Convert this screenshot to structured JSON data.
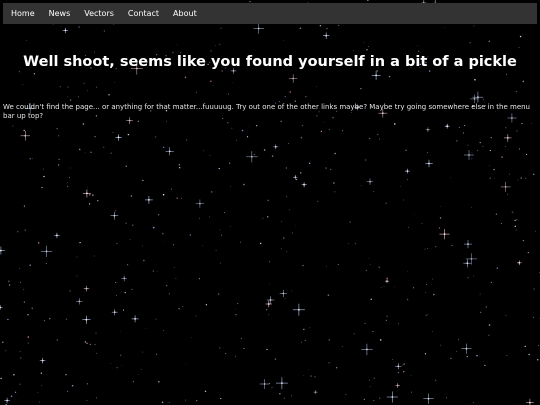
{
  "nav": {
    "items": [
      {
        "label": "Home"
      },
      {
        "label": "News"
      },
      {
        "label": "Vectors"
      },
      {
        "label": "Contact"
      },
      {
        "label": "About"
      }
    ]
  },
  "main": {
    "title": "Well shoot, seems like you found yourself in a bit of a pickle",
    "message": "We couldn't find the page... or anything for that matter...fuuuuug. Try out one of the other links maybe? Maybe try going somewhere else in the menu bar up top?"
  },
  "colors": {
    "background": "#000000",
    "navbar": "#333333",
    "text": "#ffffff"
  }
}
